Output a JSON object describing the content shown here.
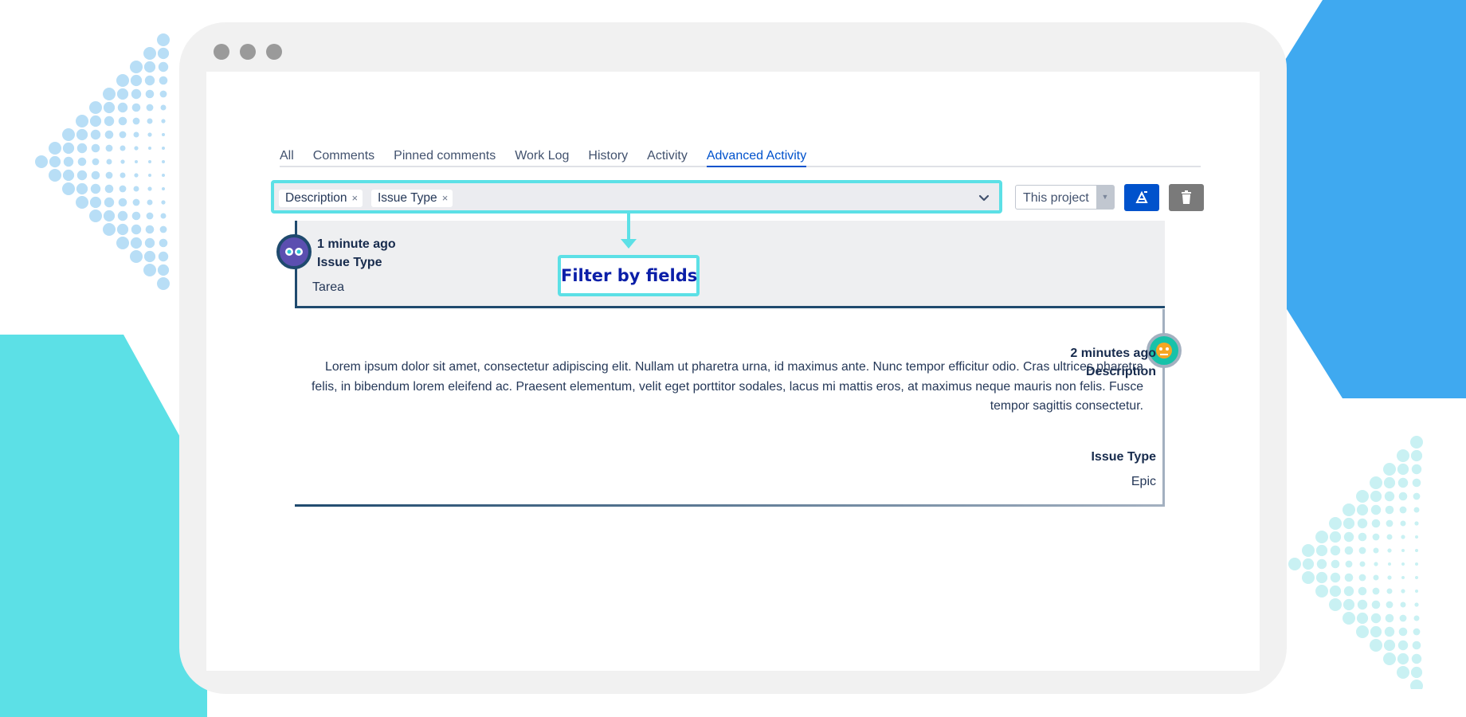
{
  "tabs": [
    {
      "label": "All",
      "active": false
    },
    {
      "label": "Comments",
      "active": false
    },
    {
      "label": "Pinned comments",
      "active": false
    },
    {
      "label": "Work Log",
      "active": false
    },
    {
      "label": "History",
      "active": false
    },
    {
      "label": "Activity",
      "active": false
    },
    {
      "label": "Advanced Activity",
      "active": true
    }
  ],
  "filter": {
    "chips": [
      {
        "label": "Description",
        "remove": "×"
      },
      {
        "label": "Issue Type",
        "remove": "×"
      }
    ]
  },
  "scope_select": {
    "value": "This project"
  },
  "callout": {
    "label": "Filter by fields"
  },
  "entries": [
    {
      "time": "1 minute ago",
      "field": "Issue Type",
      "value": "Tarea"
    },
    {
      "time": "2 minutes ago",
      "field": "Description",
      "value": "Lorem ipsum dolor sit amet, consectetur adipiscing elit. Nullam ut pharetra urna, id maximus ante. Nunc tempor efficitur odio. Cras ultrices pharetra felis, in bibendum lorem eleifend ac. Praesent elementum, velit eget porttitor sodales, lacus mi mattis eros, at maximus neque mauris non felis. Fusce tempor sagittis consectetur.",
      "field2": "Issue Type",
      "value2": "Epic"
    }
  ],
  "colors": {
    "accent": "#0052cc",
    "highlight": "#5ce0e6",
    "callout_text": "#0b1fa8",
    "deco_teal": "#5ce0e6",
    "deco_blue": "#3fa9f0"
  },
  "icons": {
    "blue_button": "filter-clear-icon",
    "gray_button": "trash-icon"
  }
}
